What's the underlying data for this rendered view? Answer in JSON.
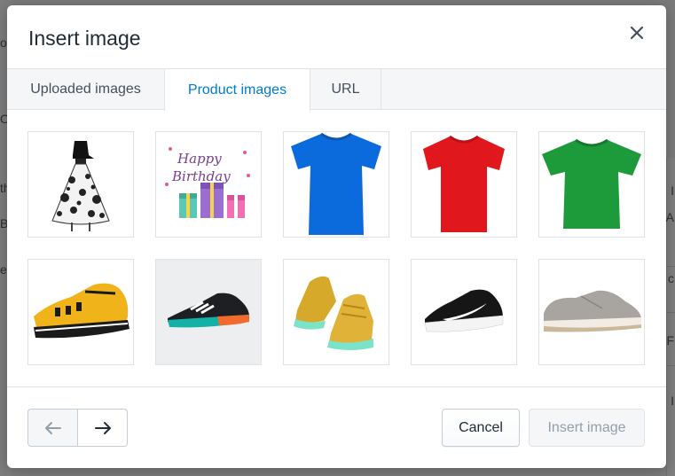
{
  "background": {
    "left_fragments": [
      "oo",
      "Ou",
      "th",
      "B",
      "e"
    ],
    "right_fragments": [
      "I",
      "A",
      "c",
      "F",
      "I"
    ]
  },
  "dialog": {
    "title": "Insert image",
    "close_icon": "close-icon"
  },
  "tabs": [
    {
      "label": "Uploaded images",
      "active": false
    },
    {
      "label": "Product images",
      "active": true
    },
    {
      "label": "URL",
      "active": false
    }
  ],
  "images": [
    {
      "name": "dress",
      "alt": "Floral dress"
    },
    {
      "name": "birthday-card",
      "alt": "Happy Birthday"
    },
    {
      "name": "blue-tshirt",
      "alt": "Blue t-shirt"
    },
    {
      "name": "red-tshirt",
      "alt": "Red t-shirt"
    },
    {
      "name": "green-tshirt",
      "alt": "Green t-shirt"
    },
    {
      "name": "yellow-sneaker",
      "alt": "Yellow sneaker"
    },
    {
      "name": "black-running-shoe",
      "alt": "Black running shoe"
    },
    {
      "name": "gold-high-tops",
      "alt": "Gold high-top sneakers"
    },
    {
      "name": "black-nike-shoe",
      "alt": "Black Nike shoe"
    },
    {
      "name": "grey-dress-shoe",
      "alt": "Grey suede shoe"
    }
  ],
  "birthday_card_text": [
    "Happy",
    "Birthday"
  ],
  "footer": {
    "prev_icon": "arrow-left-icon",
    "next_icon": "arrow-right-icon",
    "cancel_label": "Cancel",
    "insert_label": "Insert image"
  },
  "colors": {
    "accent": "#007ace",
    "title": "#212b36",
    "disabled_text": "#919eab",
    "tab_bg": "#f4f6f8",
    "border": "#dfe3e8"
  }
}
